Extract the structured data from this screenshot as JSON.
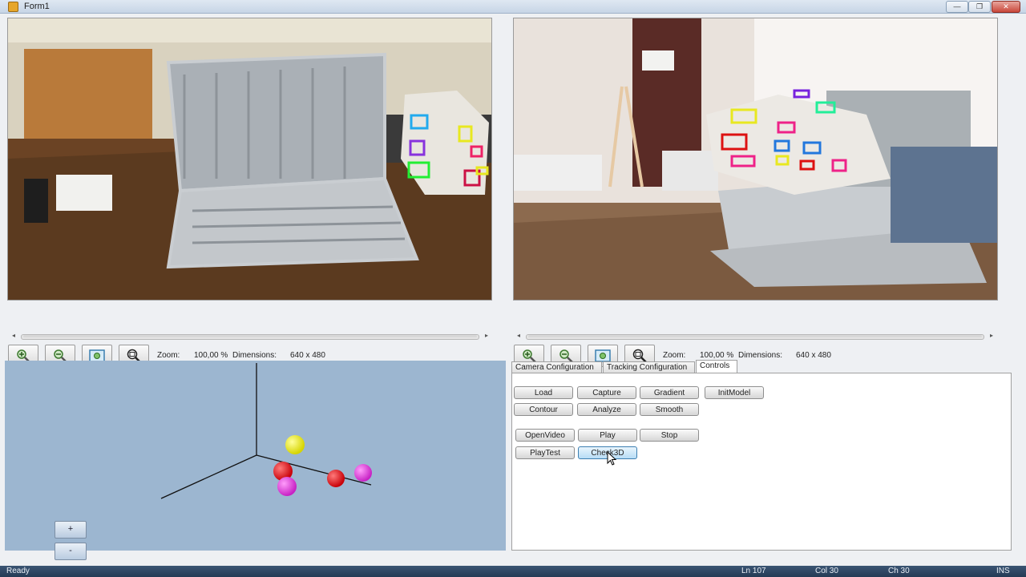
{
  "window": {
    "title": "Form1",
    "minimize_label": "—",
    "restore_label": "❐",
    "close_label": "✕"
  },
  "left_view": {
    "zoom_label": "Zoom:",
    "zoom_value": "100,00 %",
    "dimensions_label": "Dimensions:",
    "dimensions_value": "640 x 480"
  },
  "right_view": {
    "zoom_label": "Zoom:",
    "zoom_value": "100,00 %",
    "dimensions_label": "Dimensions:",
    "dimensions_value": "640 x 480"
  },
  "toolbar_icons": [
    "zoom-in-icon",
    "zoom-out-icon",
    "fit-to-window-icon",
    "actual-size-icon"
  ],
  "scene": {
    "zoom_in_label": "+",
    "zoom_out_label": "-",
    "background": "#9cb6d0",
    "sphere_colors": {
      "yellow": "#f0ee20",
      "red": "#e8101a",
      "magenta": "#e23adf"
    }
  },
  "tabs": {
    "items": [
      "Camera Configuration",
      "Tracking Configuration",
      "Controls"
    ],
    "active": "Controls"
  },
  "controls": {
    "row1": [
      "Load",
      "Capture",
      "Gradient",
      "InitModel"
    ],
    "row2": [
      "Contour",
      "Analyze",
      "Smooth"
    ],
    "row3": [
      "OpenVideo",
      "Play",
      "Stop"
    ],
    "row4": [
      "PlayTest",
      "Check3D"
    ]
  },
  "status": {
    "ready": "Ready",
    "line": "Ln 107",
    "col": "Col 30",
    "ch": "Ch 30",
    "mode": "INS"
  }
}
